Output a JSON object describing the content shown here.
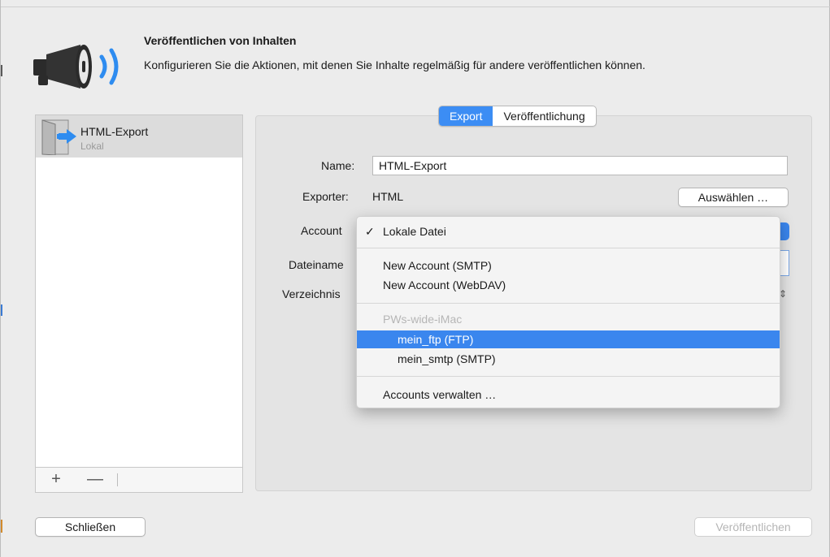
{
  "header": {
    "title": "Veröffentlichen von Inhalten",
    "description": "Konfigurieren Sie die Aktionen, mit denen Sie Inhalte regelmäßig für andere veröffentlichen können.",
    "icon": "megaphone-icon"
  },
  "sidebar": {
    "items": [
      {
        "name": "HTML-Export",
        "subtitle": "Lokal",
        "icon": "export-door-icon"
      }
    ],
    "add_label": "+",
    "remove_label": "—"
  },
  "tabs": [
    {
      "label": "Export",
      "active": true
    },
    {
      "label": "Veröffentlichung",
      "active": false
    }
  ],
  "form": {
    "name_label": "Name:",
    "name_value": "HTML-Export",
    "exporter_label": "Exporter:",
    "exporter_value": "HTML",
    "choose_button": "Auswählen …",
    "account_label": "Account",
    "filename_label": "Dateiname",
    "directory_label": "Verzeichnis"
  },
  "account_menu": {
    "items": [
      {
        "label": "Lokale Datei",
        "checked": true
      },
      {
        "label": "New Account (SMTP)"
      },
      {
        "label": "New Account (WebDAV)"
      },
      {
        "label": "PWs-wide-iMac",
        "header": true
      },
      {
        "label": "mein_ftp (FTP)",
        "highlighted": true
      },
      {
        "label": "mein_smtp (SMTP)"
      },
      {
        "label": "Accounts verwalten …"
      }
    ],
    "check_glyph": "✓"
  },
  "footer": {
    "close_button": "Schließen",
    "publish_button": "Veröffentlichen",
    "publish_enabled": false
  },
  "colors": {
    "accent": "#3a86ee",
    "window_bg": "#ececec",
    "panel_bg": "#e4e4e4",
    "disabled_text": "#b5b5b5"
  }
}
